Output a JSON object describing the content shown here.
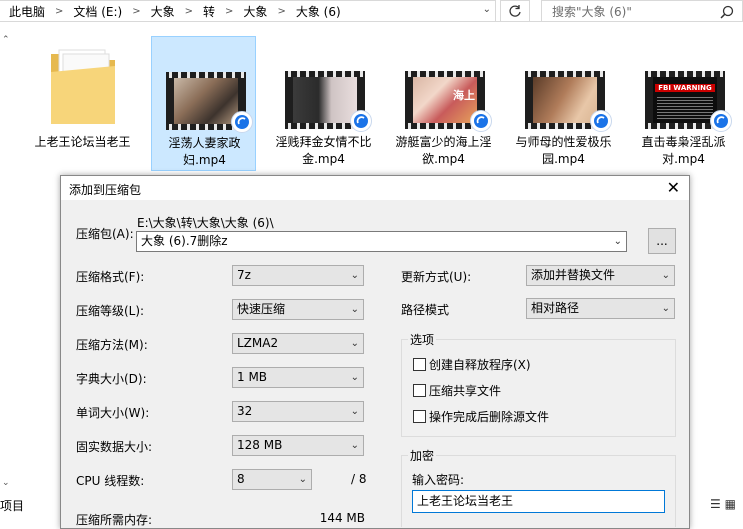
{
  "explorer": {
    "breadcrumbs": [
      "此电脑",
      "文档 (E:)",
      "大象",
      "转",
      "大象",
      "大象 (6)"
    ],
    "search_placeholder": "搜索\"大象 (6)\"",
    "status_text": "项目",
    "files": [
      {
        "label": "上老王论坛当老王",
        "kind": "folder",
        "selected": false
      },
      {
        "label": "淫荡人妻家政妇.mp4",
        "kind": "video",
        "selected": true
      },
      {
        "label": "淫贱拜金女情不比金.mp4",
        "kind": "video",
        "selected": false
      },
      {
        "label": "游艇富少的海上淫欲.mp4",
        "kind": "video",
        "selected": false
      },
      {
        "label": "与师母的性爱极乐园.mp4",
        "kind": "video",
        "selected": false
      },
      {
        "label": "直击毒枭淫乱派对.mp4",
        "kind": "video",
        "selected": false
      }
    ],
    "thumb_texts": {
      "warning": "FBI WARNING",
      "sea": "海上"
    }
  },
  "dialog": {
    "title": "添加到压缩包",
    "archive_label": "压缩包(A):",
    "archive_path": "E:\\大象\\转\\大象\\大象 (6)\\",
    "archive_name": "大象 (6).7删除z",
    "browse_label": "...",
    "format_label": "压缩格式(F):",
    "format_value": "7z",
    "level_label": "压缩等级(L):",
    "level_value": "快速压缩",
    "method_label": "压缩方法(M):",
    "method_value": "LZMA2",
    "dict_label": "字典大小(D):",
    "dict_value": "1 MB",
    "word_label": "单词大小(W):",
    "word_value": "32",
    "solid_label": "固实数据大小:",
    "solid_value": "128 MB",
    "cpu_label": "CPU 线程数:",
    "cpu_value": "8",
    "cpu_total": "/ 8",
    "mem_label": "压缩所需内存:",
    "mem_value": "144 MB",
    "update_label": "更新方式(U):",
    "update_value": "添加并替换文件",
    "path_label": "路径模式",
    "path_value": "相对路径",
    "options_title": "选项",
    "opt_sfx": "创建自释放程序(X)",
    "opt_shared": "压缩共享文件",
    "opt_delete": "操作完成后删除源文件",
    "encrypt_title": "加密",
    "password_label": "输入密码:",
    "password_value": "上老王论坛当老王"
  }
}
